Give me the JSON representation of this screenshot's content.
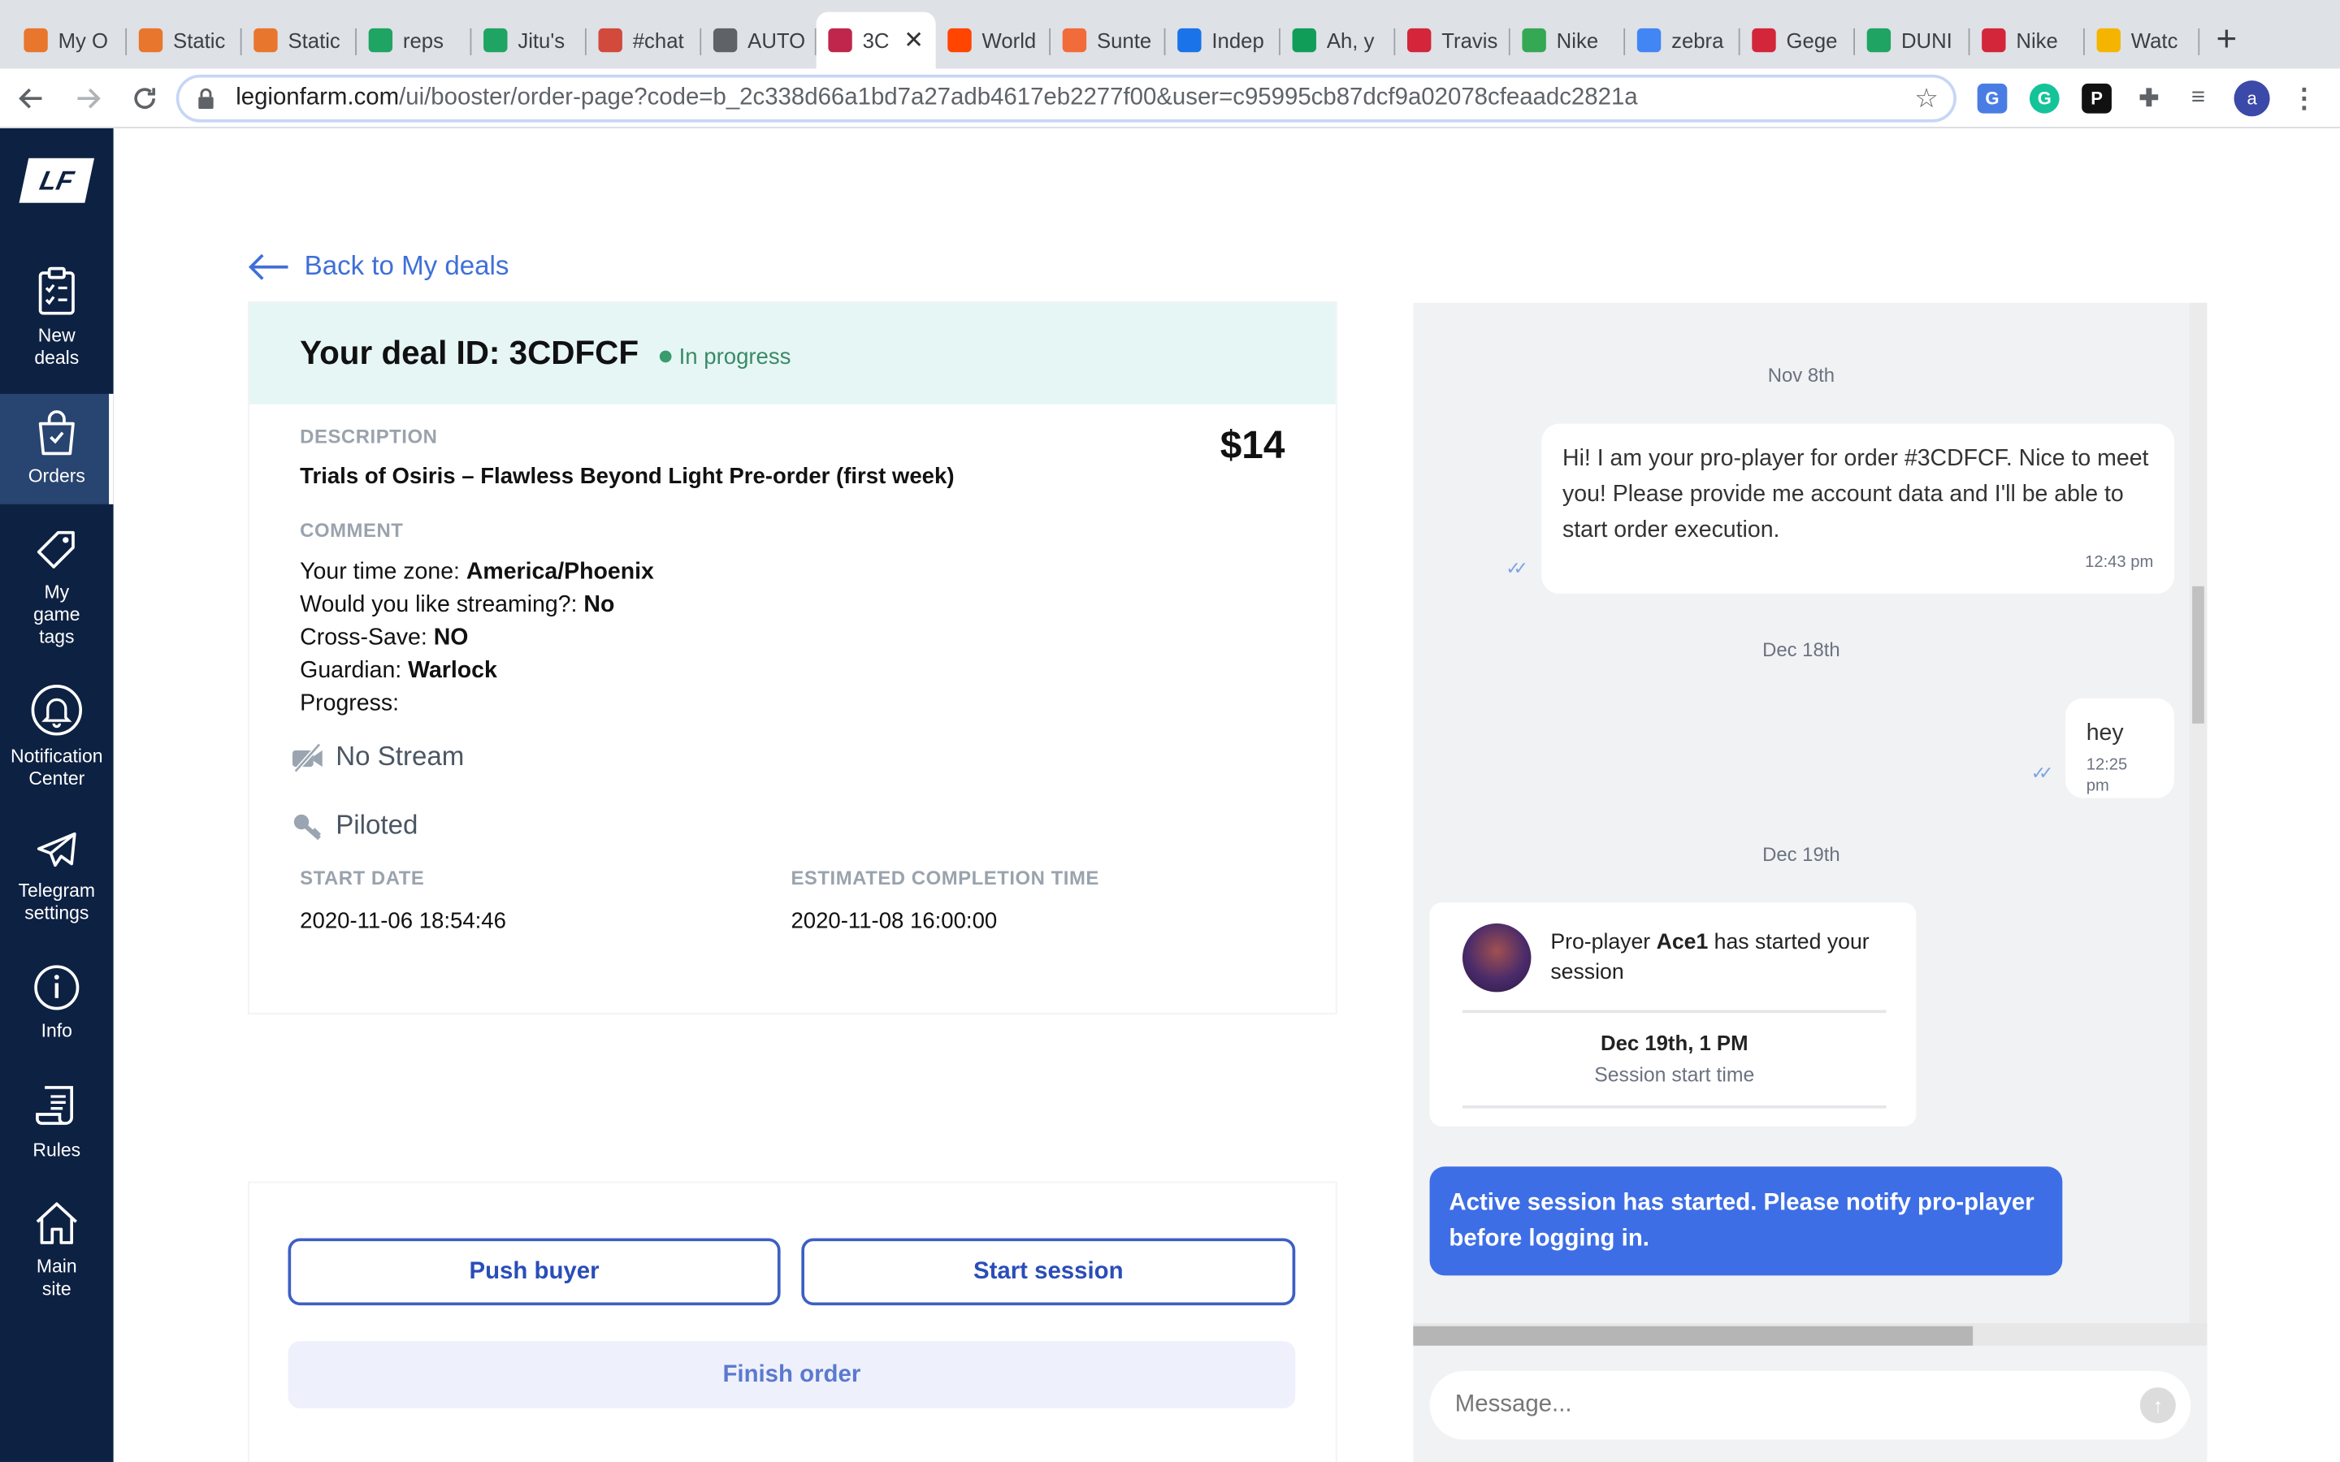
{
  "browser": {
    "tabs": [
      {
        "label": "My O",
        "fav": "#e8762c"
      },
      {
        "label": "Static",
        "fav": "#e8762c"
      },
      {
        "label": "Static",
        "fav": "#e8762c"
      },
      {
        "label": "reps",
        "fav": "#1fa463"
      },
      {
        "label": "Jitu's",
        "fav": "#1fa463"
      },
      {
        "label": "#chat",
        "fav": "#d14a3c"
      },
      {
        "label": "AUTO",
        "fav": "#5f6368"
      },
      {
        "label": "3C",
        "fav": "#c0264b",
        "active": true
      },
      {
        "label": "World",
        "fav": "#ff4500"
      },
      {
        "label": "Sunte",
        "fav": "#f26b3a"
      },
      {
        "label": "Indep",
        "fav": "#1a73e8"
      },
      {
        "label": "Ah, y",
        "fav": "#0f9d58"
      },
      {
        "label": "Travis",
        "fav": "#d3263a"
      },
      {
        "label": "Nike",
        "fav": "#34a853"
      },
      {
        "label": "zebra",
        "fav": "#4285f4"
      },
      {
        "label": "Gege",
        "fav": "#d3263a"
      },
      {
        "label": "DUNI",
        "fav": "#1fa463"
      },
      {
        "label": "Nike",
        "fav": "#d3263a"
      },
      {
        "label": "Watc",
        "fav": "#f5b400"
      }
    ],
    "url_host": "legionfarm.com",
    "url_path": "/ui/booster/order-page?code=b_2c338d66a1bd7a27adb4617eb2277f00&user=c95995cb87dcf9a02078cfeaadc2821a",
    "profile_initial": "a"
  },
  "sidebar": {
    "logo": "LF",
    "items": [
      {
        "label": "New deals"
      },
      {
        "label": "Orders"
      },
      {
        "label": "My game tags"
      },
      {
        "label": "Notification Center"
      },
      {
        "label": "Telegram settings"
      },
      {
        "label": "Info"
      },
      {
        "label": "Rules"
      },
      {
        "label": "Main site"
      }
    ]
  },
  "main": {
    "back_label": "Back to My deals",
    "deal_title": "Your deal ID: 3CDFCF",
    "status": "In progress",
    "description_label": "DESCRIPTION",
    "description": "Trials of Osiris – Flawless Beyond Light Pre-order (first week)",
    "price": "$14",
    "comment_label": "COMMENT",
    "comments": [
      {
        "key": "Your time zone: ",
        "value": "America/Phoenix"
      },
      {
        "key": "Would you like streaming?: ",
        "value": "No"
      },
      {
        "key": "Cross-Save: ",
        "value": "NO"
      },
      {
        "key": "Guardian: ",
        "value": "Warlock"
      },
      {
        "key": "Progress:",
        "value": ""
      }
    ],
    "stream_label": "No Stream",
    "piloted_label": "Piloted",
    "start_date_label": "START DATE",
    "start_date": "2020-11-06 18:54:46",
    "eta_label": "ESTIMATED COMPLETION TIME",
    "eta": "2020-11-08 16:00:00",
    "push_buyer": "Push buyer",
    "start_session": "Start session",
    "finish_order": "Finish order"
  },
  "chat": {
    "date1": "Nov 8th",
    "msg1": "Hi! I am your pro-player for order #3CDFCF. Nice to meet you! Please provide me account data and I'll be able to start order execution.",
    "msg1_time": "12:43 pm",
    "date2": "Dec 18th",
    "msg2": "hey",
    "msg2_time": "12:25 pm",
    "date3": "Dec 19th",
    "session_prefix": "Pro-player ",
    "session_player": "Ace1",
    "session_suffix": " has started your session",
    "session_date": "Dec 19th, 1 PM",
    "session_caption": "Session start time",
    "notice": "Active session has started. Please notify pro-player before logging in.",
    "input_placeholder": "Message..."
  },
  "colors": {
    "sidebar_bg": "#0d2142",
    "accent": "#3d6ee6",
    "status_green": "#3a9b6f",
    "header_bg": "#e6f6f4"
  }
}
